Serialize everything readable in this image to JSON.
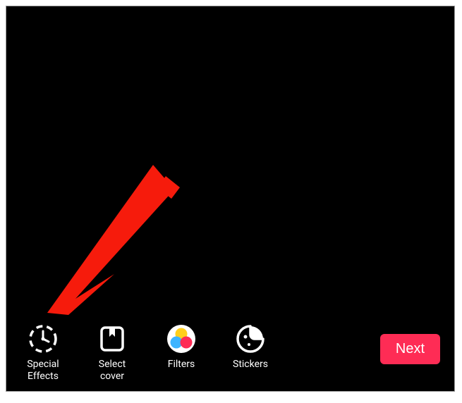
{
  "toolbar": {
    "items": [
      {
        "label": "Special\nEffects"
      },
      {
        "label": "Select\ncover"
      },
      {
        "label": "Filters"
      },
      {
        "label": "Stickers"
      }
    ],
    "next_label": "Next"
  },
  "colors": {
    "accent": "#fe2c55",
    "arrow": "#f61b0c"
  }
}
